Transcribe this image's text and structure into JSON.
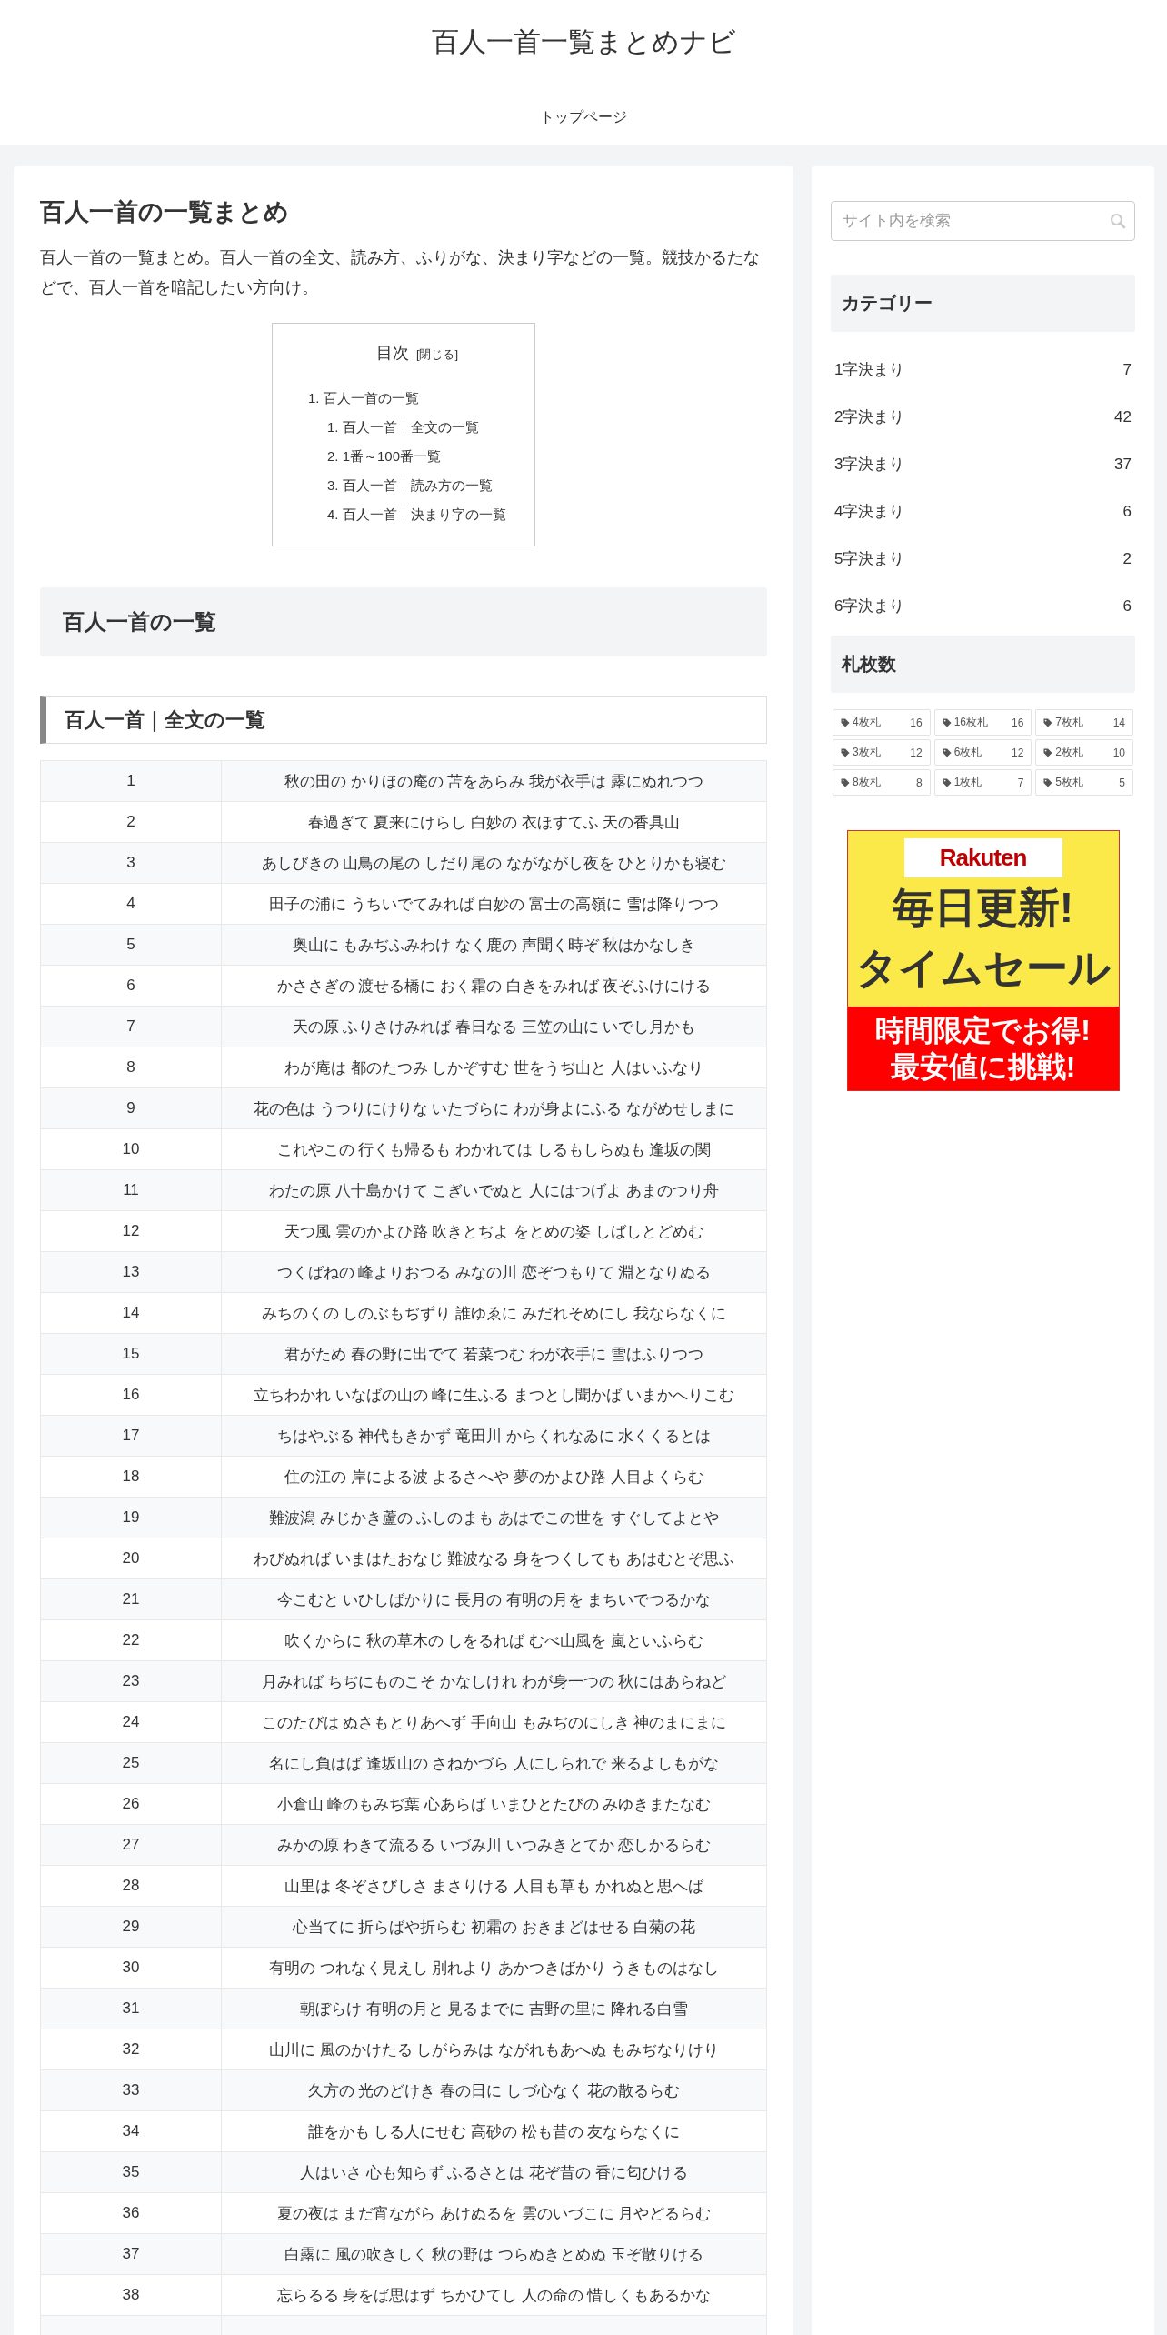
{
  "site_title": "百人一首一覧まとめナビ",
  "nav": [
    {
      "label": "トップページ"
    }
  ],
  "article": {
    "title": "百人一首の一覧まとめ",
    "intro": "百人一首の一覧まとめ。百人一首の全文、読み方、ふりがな、決まり字などの一覧。競技かるたなどで、百人一首を暗記したい方向け。",
    "toc": {
      "title": "目次",
      "toggle": "[閉じる]",
      "items": [
        {
          "number": "1.",
          "label": "百人一首の一覧",
          "children": [
            {
              "number": "1.",
              "label": "百人一首｜全文の一覧"
            },
            {
              "number": "2.",
              "label": "1番～100番一覧"
            },
            {
              "number": "3.",
              "label": "百人一首｜読み方の一覧"
            },
            {
              "number": "4.",
              "label": "百人一首｜決まり字の一覧"
            }
          ]
        }
      ]
    },
    "h2": "百人一首の一覧",
    "h3": "百人一首｜全文の一覧",
    "table": {
      "rows": [
        [
          "1",
          "秋の田の かりほの庵の 苫をあらみ 我が衣手は 露にぬれつつ"
        ],
        [
          "2",
          "春過ぎて 夏来にけらし 白妙の 衣ほすてふ 天の香具山"
        ],
        [
          "3",
          "あしびきの 山鳥の尾の しだり尾の ながながし夜を ひとりかも寝む"
        ],
        [
          "4",
          "田子の浦に うちいでてみれば 白妙の 富士の高嶺に 雪は降りつつ"
        ],
        [
          "5",
          "奥山に もみぢふみわけ なく鹿の 声聞く時ぞ 秋はかなしき"
        ],
        [
          "6",
          "かささぎの 渡せる橋に おく霜の 白きをみれば 夜ぞふけにける"
        ],
        [
          "7",
          "天の原 ふりさけみれば 春日なる 三笠の山に いでし月かも"
        ],
        [
          "8",
          "わが庵は 都のたつみ しかぞすむ 世をうぢ山と 人はいふなり"
        ],
        [
          "9",
          "花の色は うつりにけりな いたづらに わが身よにふる ながめせしまに"
        ],
        [
          "10",
          "これやこの 行くも帰るも わかれては しるもしらぬも 逢坂の関"
        ],
        [
          "11",
          "わたの原 八十島かけて こぎいでぬと 人にはつげよ あまのつり舟"
        ],
        [
          "12",
          "天つ風 雲のかよひ路 吹きとぢよ をとめの姿 しばしとどめむ"
        ],
        [
          "13",
          "つくばねの 峰よりおつる みなの川 恋ぞつもりて 淵となりぬる"
        ],
        [
          "14",
          "みちのくの しのぶもぢずり 誰ゆゑに みだれそめにし 我ならなくに"
        ],
        [
          "15",
          "君がため 春の野に出でて 若菜つむ わが衣手に 雪はふりつつ"
        ],
        [
          "16",
          "立ちわかれ いなばの山の 峰に生ふる まつとし聞かば いまかへりこむ"
        ],
        [
          "17",
          "ちはやぶる 神代もきかず 竜田川 からくれなゐに 水くくるとは"
        ],
        [
          "18",
          "住の江の 岸による波 よるさへや 夢のかよひ路 人目よくらむ"
        ],
        [
          "19",
          "難波潟 みじかき蘆の ふしのまも あはでこの世を すぐしてよとや"
        ],
        [
          "20",
          "わびぬれば いまはたおなじ 難波なる 身をつくしても あはむとぞ思ふ"
        ],
        [
          "21",
          "今こむと いひしばかりに 長月の 有明の月を まちいでつるかな"
        ],
        [
          "22",
          "吹くからに 秋の草木の しをるれば むべ山風を 嵐といふらむ"
        ],
        [
          "23",
          "月みれば ちぢにものこそ かなしけれ わが身一つの 秋にはあらねど"
        ],
        [
          "24",
          "このたびは ぬさもとりあへず 手向山 もみぢのにしき 神のまにまに"
        ],
        [
          "25",
          "名にし負はば 逢坂山の さねかづら 人にしられで 来るよしもがな"
        ],
        [
          "26",
          "小倉山 峰のもみぢ葉 心あらば いまひとたびの みゆきまたなむ"
        ],
        [
          "27",
          "みかの原 わきて流るる いづみ川 いつみきとてか 恋しかるらむ"
        ],
        [
          "28",
          "山里は 冬ぞさびしさ まさりける 人目も草も かれぬと思へば"
        ],
        [
          "29",
          "心当てに 折らばや折らむ 初霜の おきまどはせる 白菊の花"
        ],
        [
          "30",
          "有明の つれなく見えし 別れより あかつきばかり うきものはなし"
        ],
        [
          "31",
          "朝ぼらけ 有明の月と 見るまでに 吉野の里に 降れる白雪"
        ],
        [
          "32",
          "山川に 風のかけたる しがらみは ながれもあへぬ もみぢなりけり"
        ],
        [
          "33",
          "久方の 光のどけき 春の日に しづ心なく 花の散るらむ"
        ],
        [
          "34",
          "誰をかも しる人にせむ 高砂の 松も昔の 友ならなくに"
        ],
        [
          "35",
          "人はいさ 心も知らず ふるさとは 花ぞ昔の 香に匂ひける"
        ],
        [
          "36",
          "夏の夜は まだ宵ながら あけぬるを 雲のいづこに 月やどるらむ"
        ],
        [
          "37",
          "白露に 風の吹きしく 秋の野は つらぬきとめぬ 玉ぞ散りける"
        ],
        [
          "38",
          "忘らるる 身をば思はず ちかひてし 人の命の 惜しくもあるかな"
        ]
      ]
    }
  },
  "sidebar": {
    "search": {
      "placeholder": "サイト内を検索"
    },
    "categories": {
      "title": "カテゴリー",
      "items": [
        {
          "label": "1字決まり",
          "count": "7"
        },
        {
          "label": "2字決まり",
          "count": "42"
        },
        {
          "label": "3字決まり",
          "count": "37"
        },
        {
          "label": "4字決まり",
          "count": "6"
        },
        {
          "label": "5字決まり",
          "count": "2"
        },
        {
          "label": "6字決まり",
          "count": "6"
        }
      ]
    },
    "tags": {
      "title": "札枚数",
      "items": [
        {
          "label": "4枚札",
          "count": "16"
        },
        {
          "label": "16枚札",
          "count": "16"
        },
        {
          "label": "7枚札",
          "count": "14"
        },
        {
          "label": "3枚札",
          "count": "12"
        },
        {
          "label": "6枚札",
          "count": "12"
        },
        {
          "label": "2枚札",
          "count": "10"
        },
        {
          "label": "8枚札",
          "count": "8"
        },
        {
          "label": "1枚札",
          "count": "7"
        },
        {
          "label": "5枚札",
          "count": "5"
        }
      ]
    },
    "banner": {
      "logo": "Rakuten",
      "headline": [
        "毎日更新!",
        "タイムセール"
      ],
      "subline": [
        "時間限定でお得!",
        "最安値に挑戦!"
      ]
    }
  }
}
